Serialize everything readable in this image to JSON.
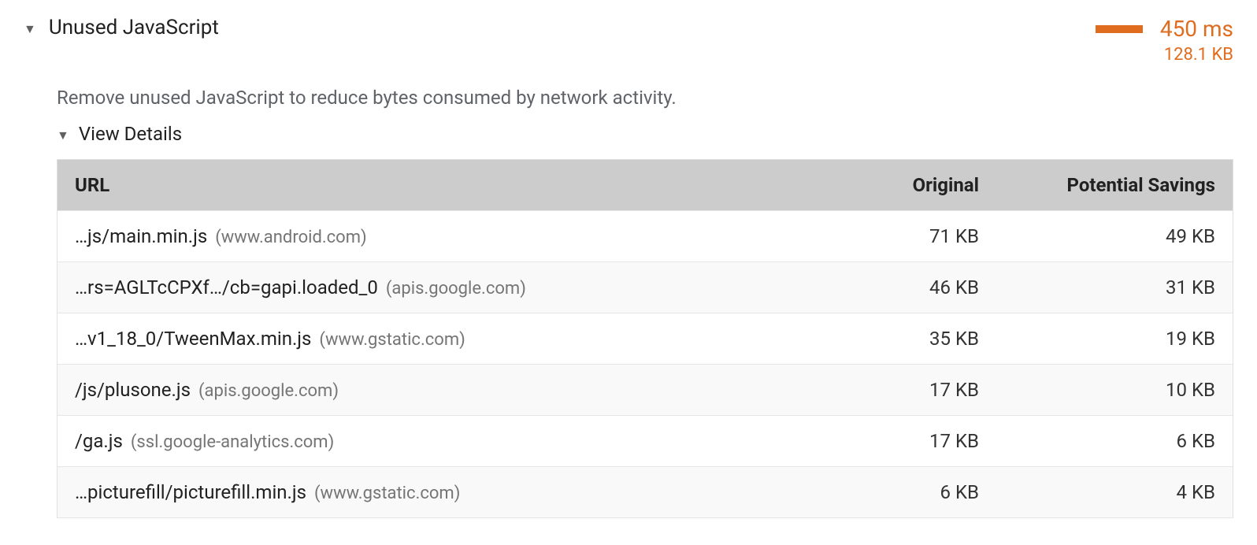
{
  "audit": {
    "title": "Unused JavaScript",
    "time_value": "450 ms",
    "size_value": "128.1 KB",
    "description": "Remove unused JavaScript to reduce bytes consumed by network activity.",
    "details_label": "View Details"
  },
  "table": {
    "headers": {
      "url": "URL",
      "original": "Original",
      "savings": "Potential Savings"
    },
    "rows": [
      {
        "path": "…js/main.min.js",
        "host": "(www.android.com)",
        "original": "71 KB",
        "savings": "49 KB"
      },
      {
        "path": "…rs=AGLTcCPXf…/cb=gapi.loaded_0",
        "host": "(apis.google.com)",
        "original": "46 KB",
        "savings": "31 KB"
      },
      {
        "path": "…v1_18_0/TweenMax.min.js",
        "host": "(www.gstatic.com)",
        "original": "35 KB",
        "savings": "19 KB"
      },
      {
        "path": "/js/plusone.js",
        "host": "(apis.google.com)",
        "original": "17 KB",
        "savings": "10 KB"
      },
      {
        "path": "/ga.js",
        "host": "(ssl.google-analytics.com)",
        "original": "17 KB",
        "savings": "6 KB"
      },
      {
        "path": "…picturefill/picturefill.min.js",
        "host": "(www.gstatic.com)",
        "original": "6 KB",
        "savings": "4 KB"
      }
    ]
  }
}
